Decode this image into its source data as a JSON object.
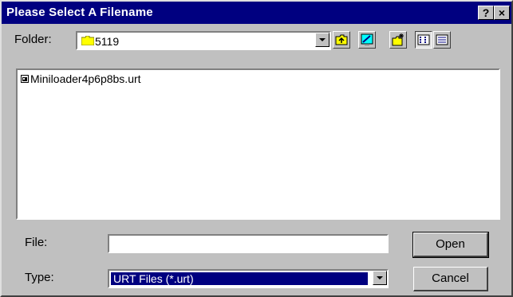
{
  "dialog": {
    "title": "Please Select A Filename",
    "help_label": "?",
    "close_label": "×"
  },
  "folder": {
    "label": "Folder:",
    "value": "5119"
  },
  "toolbar": {
    "icons": [
      "up-folder-icon",
      "desktop-icon",
      "new-folder-icon",
      "list-view-icon",
      "details-view-icon"
    ]
  },
  "files": [
    {
      "name": "Miniloader4p6p8bs.urt",
      "icon": "file-icon"
    }
  ],
  "file_field": {
    "label": "File:",
    "value": ""
  },
  "type_field": {
    "label": "Type:",
    "value": "URT Files (*.urt)"
  },
  "buttons": {
    "open": "Open",
    "cancel": "Cancel"
  },
  "colors": {
    "titlebar": "#000080",
    "face": "#c0c0c0",
    "selection": "#000080"
  }
}
